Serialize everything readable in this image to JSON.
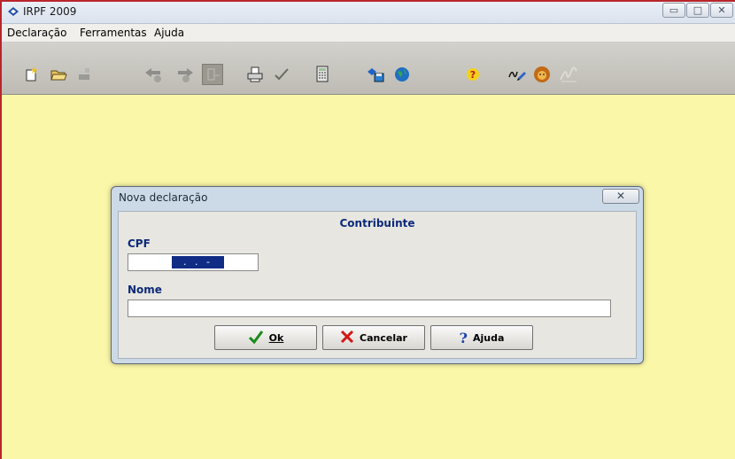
{
  "window": {
    "title": "IRPF 2009"
  },
  "menu": [
    {
      "label": "Declaração"
    },
    {
      "label": "Ferramentas"
    },
    {
      "label": "Ajuda"
    }
  ],
  "toolbar": [
    {
      "icon": "new-document-icon"
    },
    {
      "icon": "open-folder-icon"
    },
    {
      "icon": "import-disabled-icon"
    },
    {
      "icon": "back-arrow-icon"
    },
    {
      "icon": "forward-arrow-icon"
    },
    {
      "icon": "list-disabled-icon"
    },
    {
      "icon": "print-icon"
    },
    {
      "icon": "check-icon"
    },
    {
      "icon": "calculator-icon"
    },
    {
      "icon": "save-transmit-icon"
    },
    {
      "icon": "globe-icon"
    },
    {
      "icon": "help-icon"
    },
    {
      "icon": "signature-tool-icon"
    },
    {
      "icon": "lion-icon"
    },
    {
      "icon": "signature-disabled-icon"
    }
  ],
  "dialog": {
    "title": "Nova declaração",
    "section_title": "Contribuinte",
    "cpf_label": "CPF",
    "cpf_value": ". . -",
    "nome_label": "Nome",
    "nome_value": "",
    "buttons": {
      "ok": "Ok",
      "cancel": "Cancelar",
      "help": "Ajuda"
    }
  },
  "colors": {
    "workspace": "#fbf7a8",
    "label_blue": "#0b2a78",
    "selection": "#102c85"
  }
}
